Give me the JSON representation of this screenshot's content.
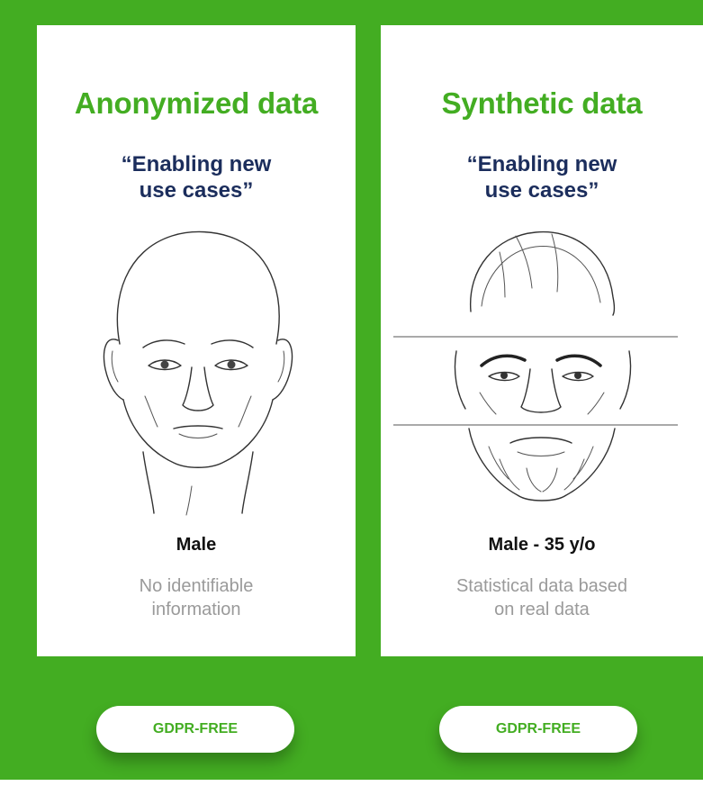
{
  "cards": [
    {
      "title": "Anonymized data",
      "quote_line1": "“Enabling new",
      "quote_line2": "use cases”",
      "label": "Male",
      "desc_line1": "No identifiable",
      "desc_line2": "information",
      "button_label": "GDPR-FREE"
    },
    {
      "title": "Synthetic data",
      "quote_line1": "“Enabling new",
      "quote_line2": "use cases”",
      "label": "Male - 35 y/o",
      "desc_line1": "Statistical data based",
      "desc_line2": "on real data",
      "button_label": "GDPR-FREE"
    }
  ],
  "colors": {
    "background_green": "#43ad22",
    "title_green": "#43ad22",
    "quote_navy": "#1b2d5c",
    "desc_gray": "#9a9a9a"
  },
  "icons": {
    "left_illustration": "bald-male-face-sketch-icon",
    "right_illustration": "bearded-male-face-sketch-icon"
  }
}
